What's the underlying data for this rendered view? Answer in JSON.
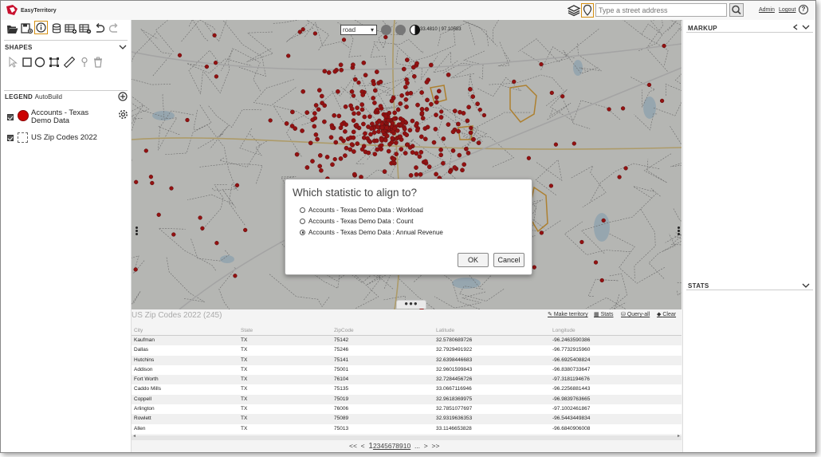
{
  "app": {
    "logo_text": "EasyTerritory"
  },
  "topbar": {
    "address_placeholder": "Type a street address",
    "admin_label": "Admin",
    "logout_label": "Logout",
    "help_label": "?"
  },
  "shapes_panel": {
    "title": "SHAPES"
  },
  "legend": {
    "title": "LEGEND",
    "subtitle": "AutoBuild",
    "items": [
      {
        "label_line1": "Accounts - Texas",
        "label_line2": "Demo Data",
        "color": "#cc0000",
        "checked": true
      },
      {
        "label_line1": "US Zip Codes 2022",
        "label_line2": "",
        "checked": true
      }
    ]
  },
  "map": {
    "basemap_select": "road",
    "coordinate_readout": "33.4810 | 97.10583"
  },
  "dialog": {
    "title": "Which statistic to align to?",
    "options": [
      {
        "label": "Accounts - Texas Demo Data : Workload",
        "checked": false
      },
      {
        "label": "Accounts - Texas Demo Data : Count",
        "checked": false
      },
      {
        "label": "Accounts - Texas Demo Data : Annual Revenue",
        "checked": true
      }
    ],
    "ok_label": "OK",
    "cancel_label": "Cancel"
  },
  "table_panel": {
    "title": "US Zip Codes 2022 (245)",
    "actions": {
      "make_territory": "Make territory",
      "stats": "Stats",
      "query_all": "Query-all",
      "clear": "Clear"
    },
    "columns": [
      "City",
      "State",
      "ZipCode",
      "Latitude",
      "Longitude"
    ],
    "rows": [
      [
        "Kaufman",
        "TX",
        "75142",
        "32.5780689726",
        "-96.2463590386"
      ],
      [
        "Dallas",
        "TX",
        "75246",
        "32.7929491922",
        "-96.7732915960"
      ],
      [
        "Hutchins",
        "TX",
        "75141",
        "32.6398446683",
        "-96.6925408824"
      ],
      [
        "Addison",
        "TX",
        "75001",
        "32.9601599843",
        "-96.8380733647"
      ],
      [
        "Fort Worth",
        "TX",
        "76104",
        "32.7284456726",
        "-97.3181194676"
      ],
      [
        "Caddo Mills",
        "TX",
        "75135",
        "33.0667116946",
        "-96.2256881443"
      ],
      [
        "Coppell",
        "TX",
        "75019",
        "32.9618369975",
        "-96.9839763665"
      ],
      [
        "Arlington",
        "TX",
        "76006",
        "32.7851077697",
        "-97.1002461867"
      ],
      [
        "Rowlett",
        "TX",
        "75089",
        "32.9319636353",
        "-96.5443449834"
      ],
      [
        "Allen",
        "TX",
        "75013",
        "33.1146653828",
        "-96.6840906008"
      ]
    ],
    "pager": {
      "first": "<<",
      "prev": "<",
      "pages": "12345678910",
      "current": "1",
      "ellipsis": "...",
      "next": ">",
      "last": ">>"
    }
  },
  "right_panel": {
    "markup_title": "MARKUP",
    "stats_title": "STATS"
  }
}
